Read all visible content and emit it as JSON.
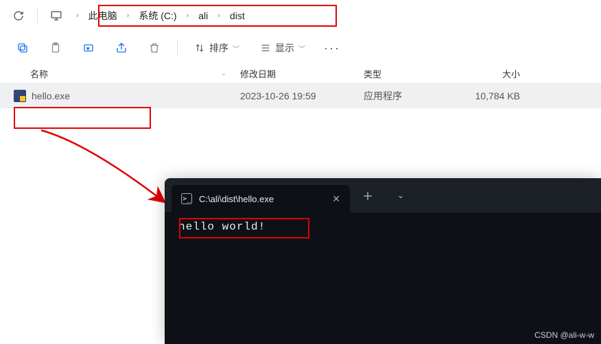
{
  "nav": {
    "crumbs": [
      "此电脑",
      "系统 (C:)",
      "ali",
      "dist"
    ]
  },
  "toolbar": {
    "sort_label": "排序",
    "view_label": "显示"
  },
  "columns": {
    "name": "名称",
    "modified": "修改日期",
    "type": "类型",
    "size": "大小"
  },
  "files": [
    {
      "name": "hello.exe",
      "modified": "2023-10-26 19:59",
      "type": "应用程序",
      "size": "10,784 KB"
    }
  ],
  "terminal": {
    "tab_title": "C:\\ali\\dist\\hello.exe",
    "output": "hello world!"
  },
  "watermark": "CSDN @ali-w-w"
}
